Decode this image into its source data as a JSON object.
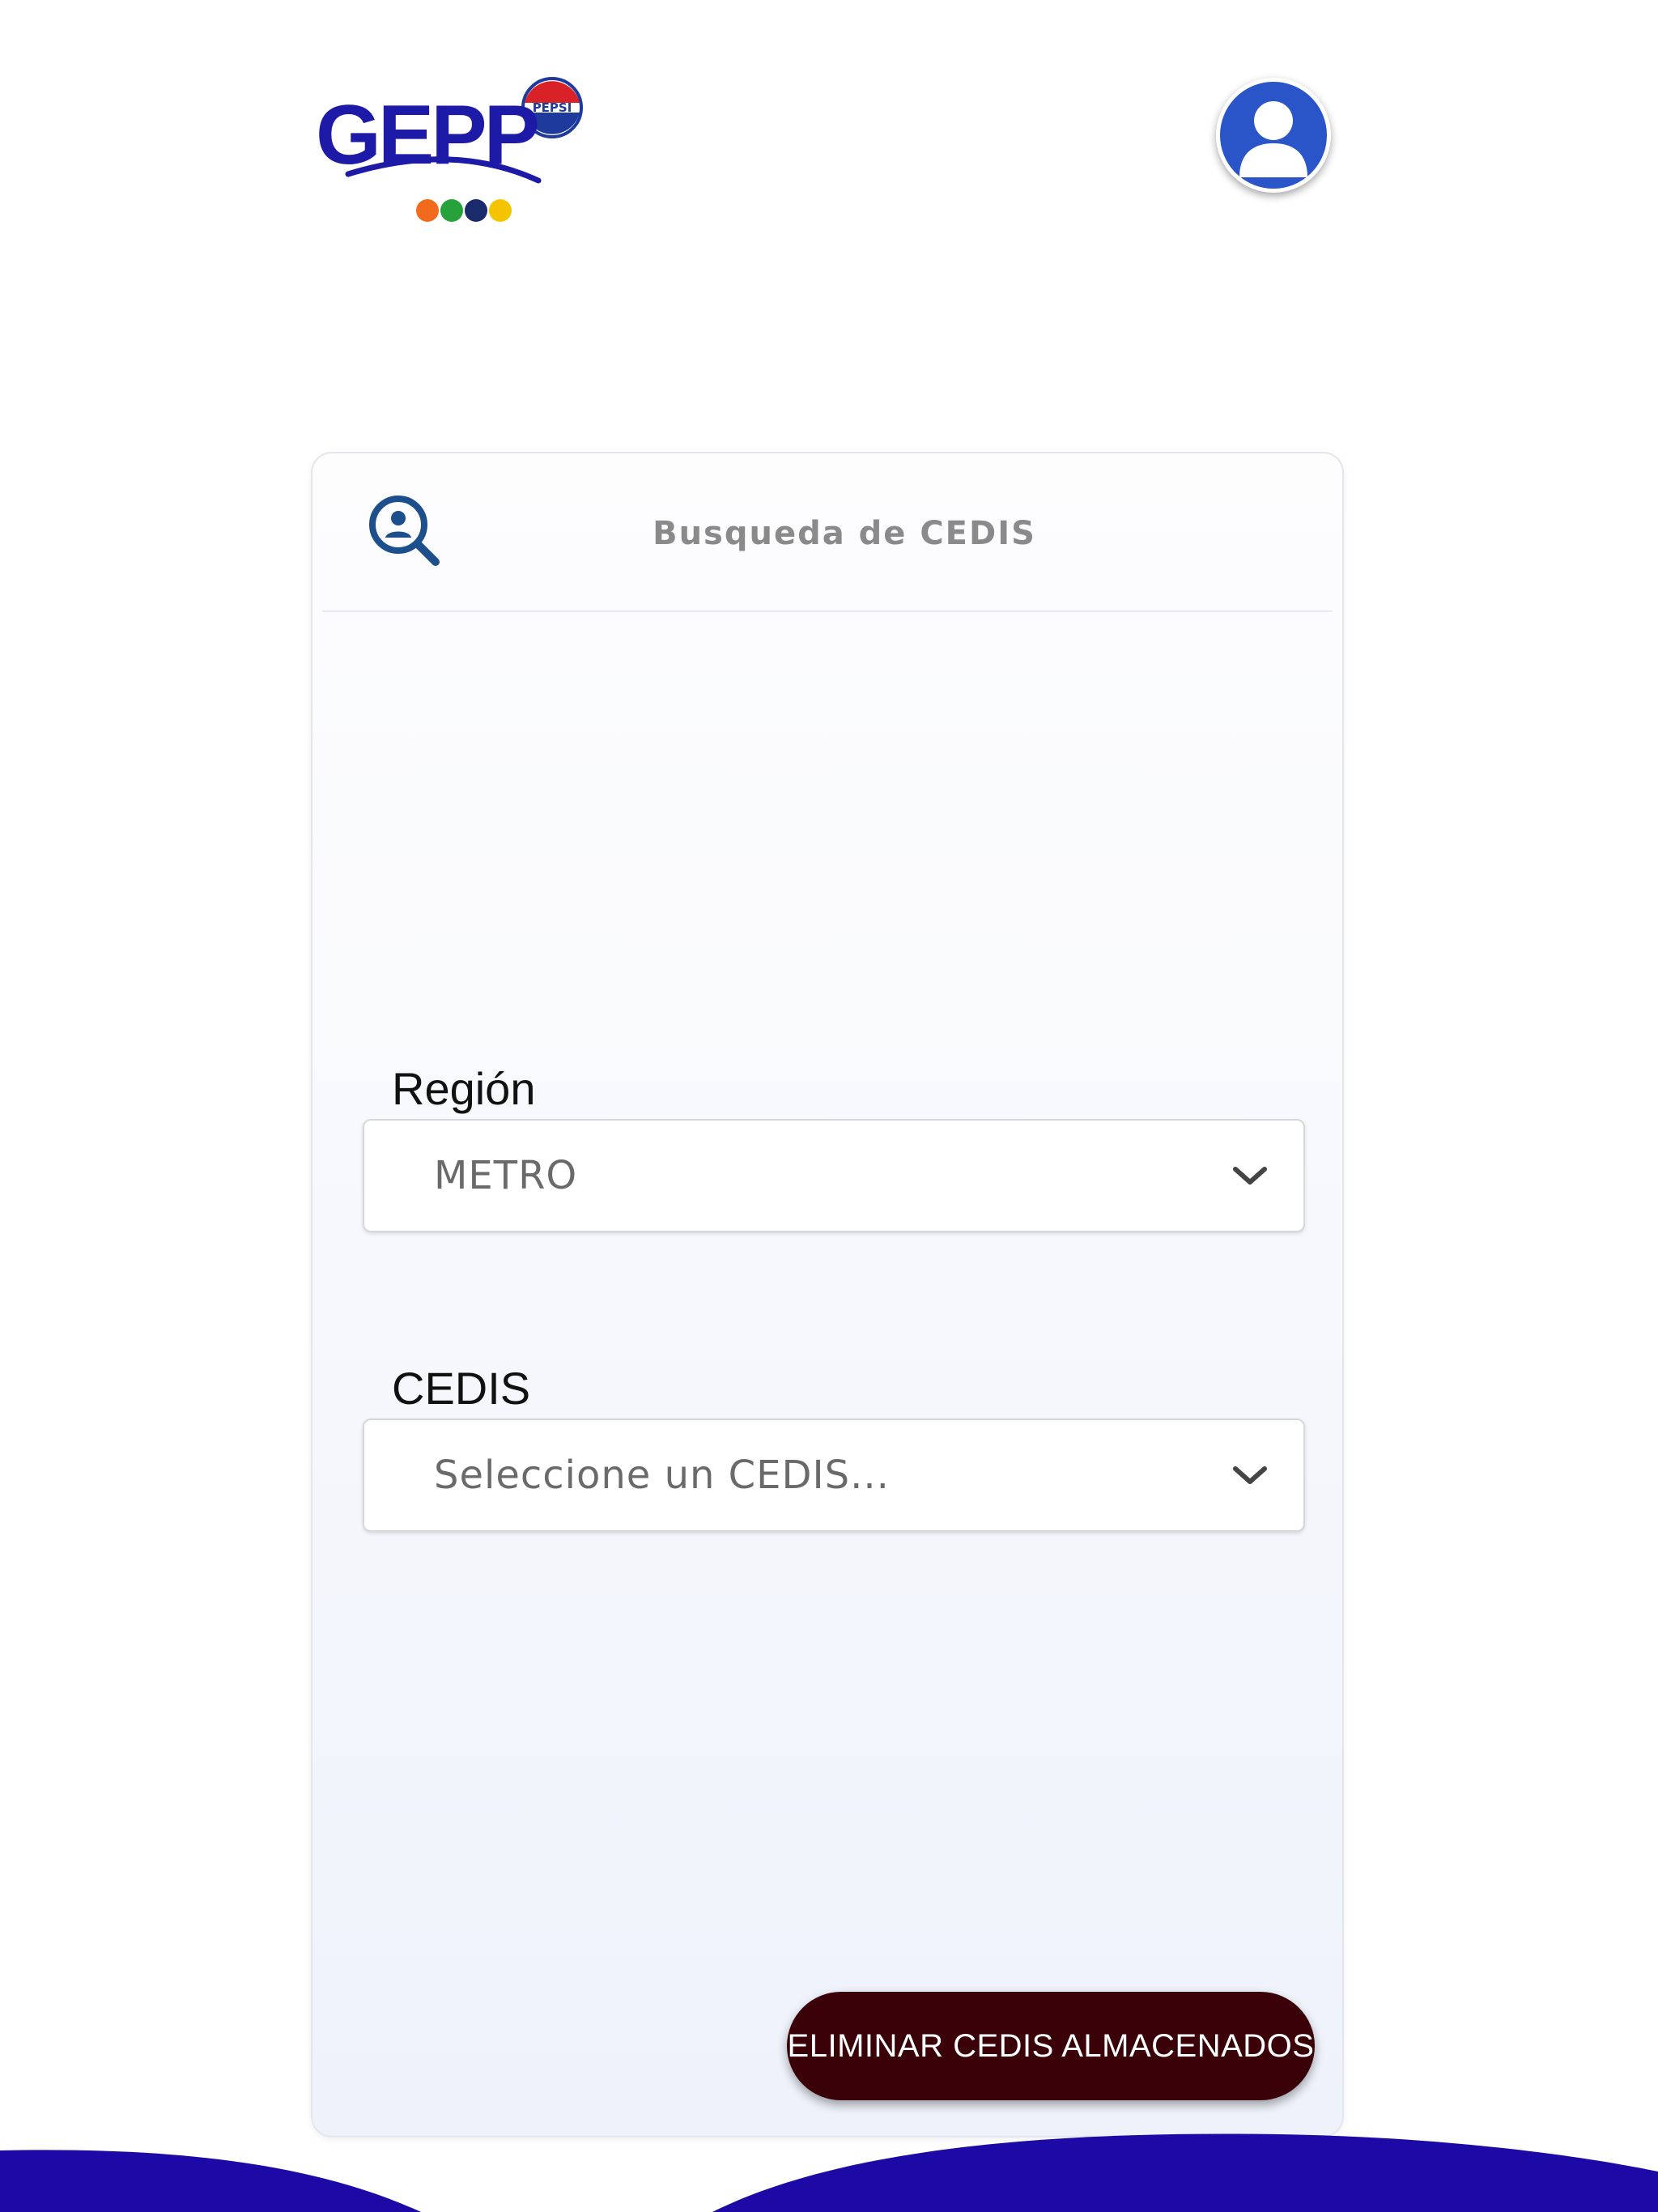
{
  "header": {
    "logo": {
      "wordmark": "GEPP",
      "badge": "PEPSI",
      "icon": "gepp-logo",
      "colors": {
        "wordmark": "#1e1aa8",
        "badge_red": "#d92128",
        "badge_blue": "#1e3a9c"
      }
    },
    "avatar": {
      "icon": "user-avatar-icon",
      "color": "#2955c9"
    }
  },
  "card": {
    "title": "Busqueda de CEDIS",
    "title_icon": "search-person-icon",
    "icon_color": "#1d4f8c"
  },
  "form": {
    "region": {
      "label": "Región",
      "value": "METRO",
      "icon": "chevron-down-icon"
    },
    "cedis": {
      "label": "CEDIS",
      "placeholder": "Seleccione un CEDIS...",
      "icon": "chevron-down-icon"
    }
  },
  "actions": {
    "delete_label": "ELIMINAR CEDIS ALMACENADOS",
    "delete_color": "#3a0208"
  },
  "theme": {
    "wave_color": "#1d0aa6"
  }
}
